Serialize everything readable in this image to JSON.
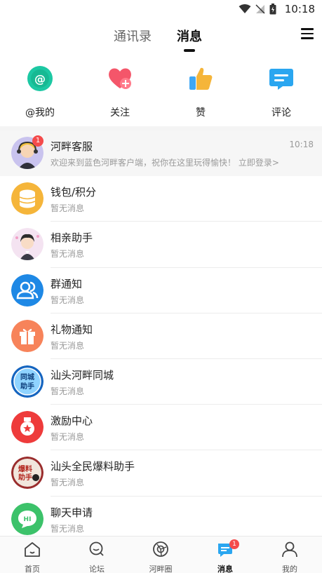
{
  "status_bar": {
    "time": "10:18"
  },
  "top_tabs": {
    "contacts": "通讯录",
    "messages": "消息"
  },
  "quick_actions": [
    {
      "label": "@我的",
      "icon": "at-icon",
      "color": "#1cc8a3"
    },
    {
      "label": "关注",
      "icon": "heart-plus-icon",
      "color": "#f4566a"
    },
    {
      "label": "赞",
      "icon": "thumbs-up-icon",
      "color": "#f5b53a"
    },
    {
      "label": "评论",
      "icon": "comment-icon",
      "color": "#2aa6f0"
    }
  ],
  "messages": [
    {
      "title": "河畔客服",
      "subtitle": "欢迎来到蓝色河畔客户端，祝你在这里玩得愉快！",
      "link": "立即登录>",
      "time": "10:18",
      "badge": "1"
    },
    {
      "title": "钱包/积分",
      "subtitle": "暂无消息"
    },
    {
      "title": "相亲助手",
      "subtitle": "暂无消息"
    },
    {
      "title": "群通知",
      "subtitle": "暂无消息"
    },
    {
      "title": "礼物通知",
      "subtitle": "暂无消息"
    },
    {
      "title": "汕头河畔同城",
      "subtitle": "暂无消息"
    },
    {
      "title": "激励中心",
      "subtitle": "暂无消息"
    },
    {
      "title": "汕头全民爆料助手",
      "subtitle": "暂无消息"
    },
    {
      "title": "聊天申请",
      "subtitle": "暂无消息"
    }
  ],
  "avatar_text": {
    "tongcheng_1": "同城",
    "tongcheng_2": "助手",
    "baoliao_1": "爆料",
    "baoliao_2": "助手",
    "hi": "HI"
  },
  "bottom_nav": [
    {
      "label": "首页",
      "icon": "home-icon"
    },
    {
      "label": "论坛",
      "icon": "forum-icon"
    },
    {
      "label": "河畔圈",
      "icon": "camera-ring-icon"
    },
    {
      "label": "消息",
      "icon": "message-icon",
      "badge": "1",
      "active": true
    },
    {
      "label": "我的",
      "icon": "profile-icon"
    }
  ],
  "colors": {
    "badge": "#f44b4b",
    "accent_blue": "#2aa6f0",
    "wallet": "#f5b53a",
    "group": "#1e88e5",
    "gift": "#f7835a",
    "incentive": "#ee3b3b",
    "chat": "#3cc26a"
  }
}
